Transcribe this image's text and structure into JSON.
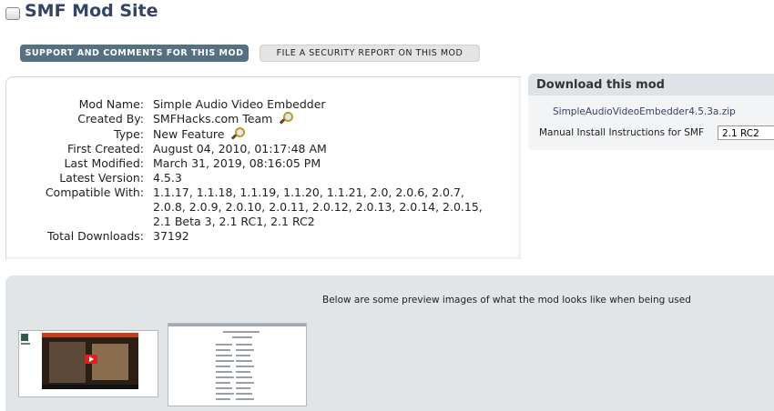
{
  "header": {
    "title": "SMF Mod Site"
  },
  "tabs": [
    {
      "label": "SUPPORT AND COMMENTS FOR THIS MOD",
      "active": true
    },
    {
      "label": "FILE A SECURITY REPORT ON THIS MOD",
      "active": false
    }
  ],
  "mod_info": {
    "rows": [
      {
        "label": "Mod Name:",
        "value": "Simple Audio Video Embedder"
      },
      {
        "label": "Created By:",
        "value": "SMFHacks.com Team",
        "icon": "magnifier-icon"
      },
      {
        "label": "Type:",
        "value": "New Feature",
        "icon": "magnifier-icon"
      },
      {
        "label": "First Created:",
        "value": "August 04, 2010, 01:17:48 AM"
      },
      {
        "label": "Last Modified:",
        "value": "March 31, 2019, 08:16:05 PM"
      },
      {
        "label": "Latest Version:",
        "value": "4.5.3"
      },
      {
        "label": "Compatible With:",
        "value_lines": [
          "1.1.17, 1.1.18, 1.1.19, 1.1.20, 1.1.21, 2.0, 2.0.6, 2.0.7,",
          "2.0.8, 2.0.9, 2.0.10, 2.0.11, 2.0.12, 2.0.13, 2.0.14, 2.0.15,",
          "2.1 Beta 3, 2.1 RC1, 2.1 RC2"
        ]
      },
      {
        "label": "Total Downloads:",
        "value": "37192"
      }
    ]
  },
  "download": {
    "title": "Download this mod",
    "file_link": "SimpleAudioVideoEmbedder4.5.3a.zip",
    "manual_label": "Manual Install Instructions for SMF",
    "selected_version": "2.1 RC2"
  },
  "preview": {
    "caption": "Below are some preview images of what the mod looks like when being used",
    "thumbnails": [
      {
        "name": "preview-thumbnail-1"
      },
      {
        "name": "preview-thumbnail-2"
      }
    ]
  },
  "colors": {
    "title": "#334466",
    "active_tab": "#557083",
    "panel_bg": "#e2e5e8",
    "download_head": "#dfe3e8"
  }
}
